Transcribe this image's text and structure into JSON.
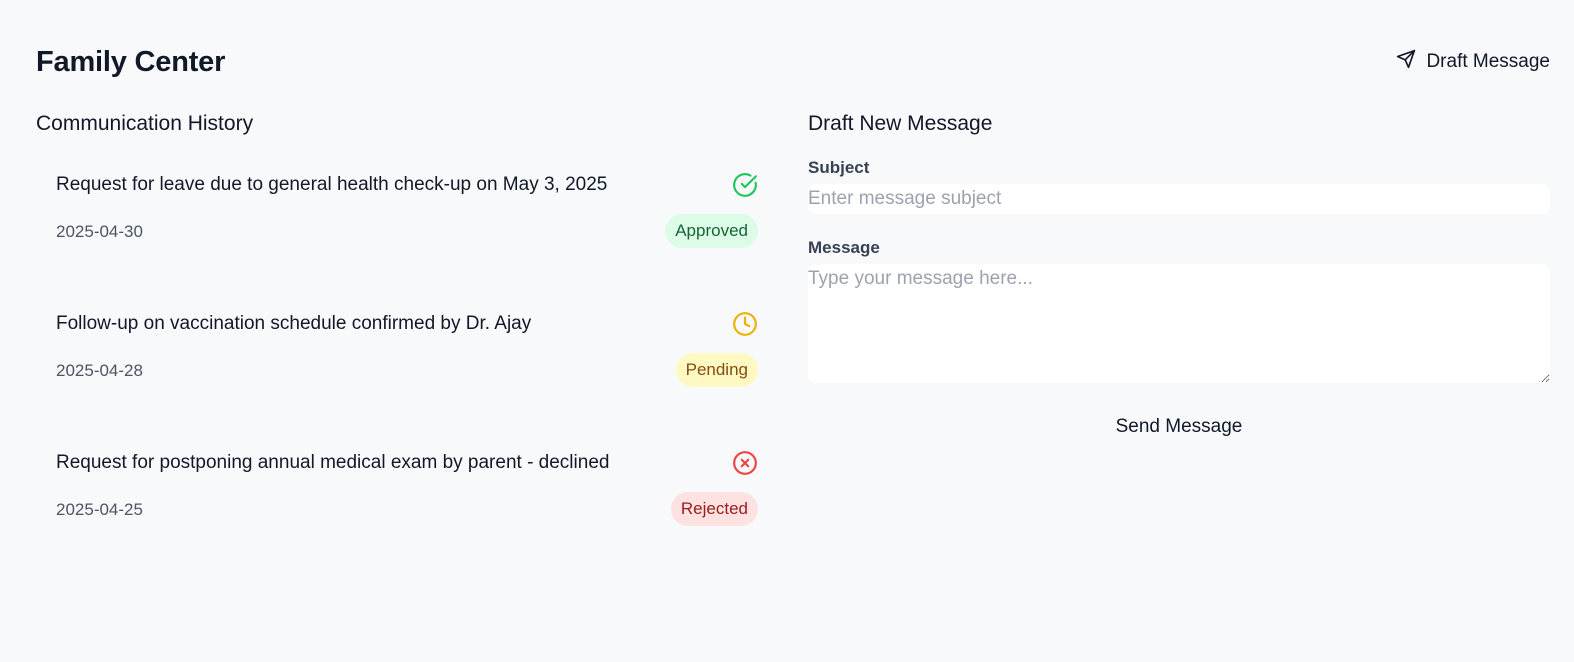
{
  "header": {
    "title": "Family Center",
    "draft_button_label": "Draft Message",
    "draft_button_icon": "send-icon"
  },
  "history": {
    "title": "Communication History",
    "items": [
      {
        "subject": "Request for leave due to general health check-up on May 3, 2025",
        "date": "2025-04-30",
        "status": "Approved",
        "icon": "check-circle-icon",
        "color": "#22c55e",
        "badge_bg": "#dcfce7",
        "badge_text_color": "#166534"
      },
      {
        "subject": "Follow-up on vaccination schedule confirmed by Dr. Ajay",
        "date": "2025-04-28",
        "status": "Pending",
        "icon": "clock-icon",
        "color": "#eab308",
        "badge_bg": "#fef9c3",
        "badge_text_color": "#854d0e"
      },
      {
        "subject": "Request for postponing annual medical exam by parent - declined",
        "date": "2025-04-25",
        "status": "Rejected",
        "icon": "x-circle-icon",
        "color": "#ef4444",
        "badge_bg": "#fee2e2",
        "badge_text_color": "#991b1b"
      }
    ]
  },
  "draft": {
    "title": "Draft New Message",
    "subject_label": "Subject",
    "subject_placeholder": "Enter message subject",
    "subject_value": "",
    "message_label": "Message",
    "message_placeholder": "Type your message here...",
    "message_value": "",
    "send_label": "Send Message"
  }
}
